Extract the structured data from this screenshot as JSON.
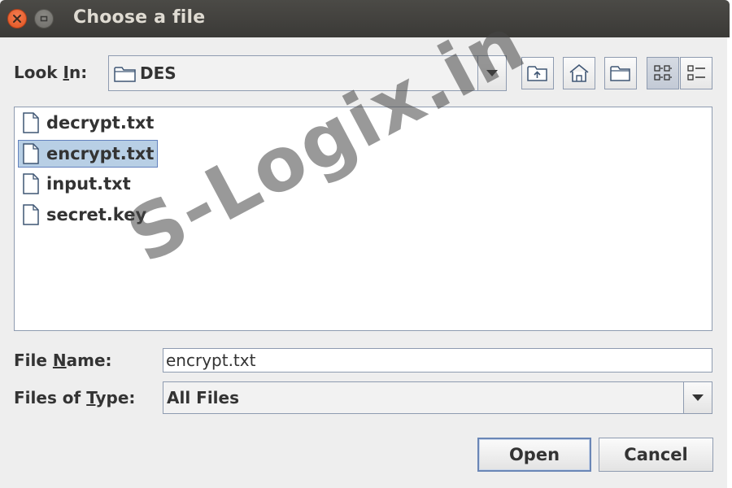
{
  "window": {
    "title": "Choose a file"
  },
  "look_in": {
    "label_pre": "Look ",
    "label_mnemonic": "I",
    "label_post": "n:",
    "value": "DES"
  },
  "toolbar": {
    "buttons": [
      {
        "icon": "up-folder-icon"
      },
      {
        "icon": "home-icon"
      },
      {
        "icon": "new-folder-icon"
      },
      {
        "icon": "list-view-icon",
        "active": true
      },
      {
        "icon": "details-view-icon"
      }
    ]
  },
  "files": [
    {
      "name": "decrypt.txt",
      "selected": false
    },
    {
      "name": "encrypt.txt",
      "selected": true
    },
    {
      "name": "input.txt",
      "selected": false
    },
    {
      "name": "secret.key",
      "selected": false
    }
  ],
  "file_name": {
    "label_pre": "File ",
    "label_mnemonic": "N",
    "label_post": "ame:",
    "value": "encrypt.txt"
  },
  "file_type": {
    "label_pre": "Files of ",
    "label_mnemonic": "T",
    "label_post": "ype:",
    "value": "All Files"
  },
  "buttons": {
    "open": "Open",
    "cancel": "Cancel"
  },
  "watermark": "S-Logix.in",
  "colors": {
    "titlebar": "#3c3b37",
    "close_button": "#e9541e",
    "selection": "#b8cfe5",
    "border": "#8e9bb0"
  }
}
